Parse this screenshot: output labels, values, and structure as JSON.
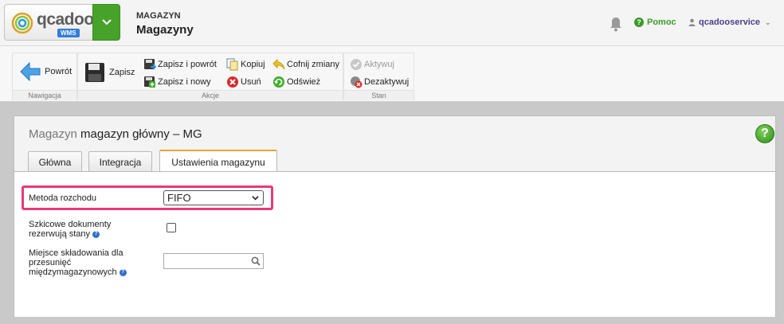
{
  "header": {
    "logo_text": "qcadoo",
    "logo_badge": "WMS",
    "breadcrumb_parent": "MAGAZYN",
    "breadcrumb_current": "Magazyny",
    "help_label": "Pomoc",
    "user_label": "qcadooservice"
  },
  "ribbon": {
    "navigation": {
      "label": "Nawigacja",
      "back_label": "Powrót"
    },
    "actions": {
      "label": "Akcje",
      "save_label": "Zapisz",
      "save_back_label": "Zapisz i powrót",
      "save_new_label": "Zapisz i nowy",
      "copy_label": "Kopiuj",
      "delete_label": "Usuń",
      "undo_label": "Cofnij zmiany",
      "refresh_label": "Odśwież"
    },
    "state": {
      "label": "Stan",
      "activate_label": "Aktywuj",
      "deactivate_label": "Dezaktywuj"
    }
  },
  "panel": {
    "title_prefix": "Magazyn",
    "title_value": "magazyn główny – MG",
    "tabs": [
      {
        "label": "Główna"
      },
      {
        "label": "Integracja"
      },
      {
        "label": "Ustawienia magazynu"
      }
    ],
    "fields": {
      "release_method": {
        "label": "Metoda rozchodu",
        "value": "FIFO"
      },
      "draft_reserve": {
        "label_line1": "Szkicowe dokumenty",
        "label_line2": "rezerwują stany",
        "checked": false
      },
      "storage_location": {
        "label_line1": "Miejsce składowania dla",
        "label_line2": "przesunięć",
        "label_line3": "międzymagazynowych",
        "value": ""
      }
    }
  },
  "colors": {
    "brand_green": "#47a229",
    "highlight": "#e6397a",
    "tab_accent": "#e8a33b",
    "user_link": "#4a3f8c"
  }
}
